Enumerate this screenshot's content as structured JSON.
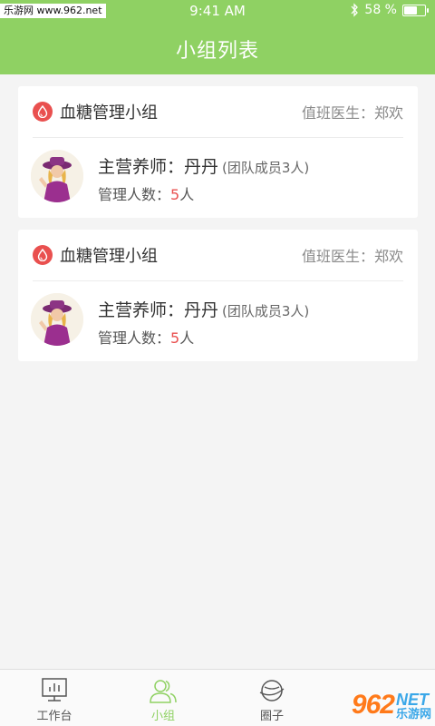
{
  "status_bar": {
    "watermark": "乐游网 www.962.net",
    "time": "9:41 AM",
    "battery": "58 %",
    "battery_level": 0.58
  },
  "header": {
    "title": "小组列表"
  },
  "groups": [
    {
      "name": "血糖管理小组",
      "doctor_label": "值班医生：郑欢",
      "nutritionist": "主营养师：丹丹",
      "members": "(团队成员3人)",
      "managed_label": "管理人数：",
      "managed_count": "5",
      "managed_unit": "人",
      "icon": "blood-drop-icon",
      "badge_color": "#e9504f"
    },
    {
      "name": "血糖管理小组",
      "doctor_label": "值班医生：郑欢",
      "nutritionist": "主营养师：丹丹",
      "members": "(团队成员3人)",
      "managed_label": "管理人数：",
      "managed_count": "5",
      "managed_unit": "人",
      "icon": "blood-drop-icon",
      "badge_color": "#e9504f"
    }
  ],
  "tabs": [
    {
      "label": "工作台",
      "icon": "workbench-icon",
      "active": false
    },
    {
      "label": "小组",
      "icon": "group-icon",
      "active": true
    },
    {
      "label": "圈子",
      "icon": "circle-planet-icon",
      "active": false
    }
  ],
  "watermark_bottom": {
    "number": "962",
    "net": "NET",
    "cn": "乐游网"
  },
  "colors": {
    "accent": "#8fd163",
    "danger": "#e9504f",
    "background": "#f4f4f4"
  }
}
